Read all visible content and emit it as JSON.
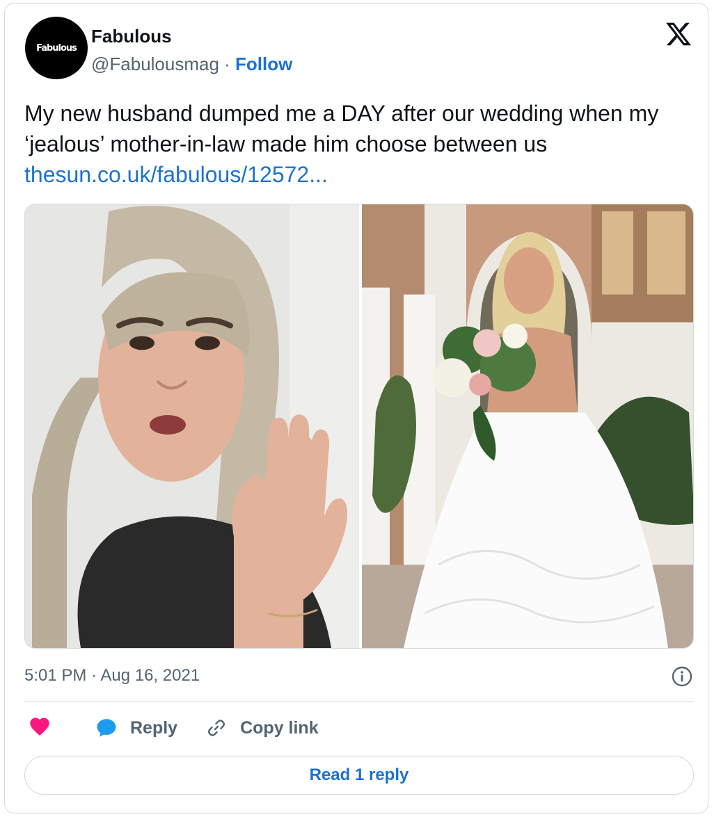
{
  "tweet": {
    "author": {
      "avatar_text": "Fabulous",
      "display_name": "Fabulous",
      "handle": "@Fabulousmag",
      "separator": " · ",
      "follow_label": "Follow"
    },
    "text": "My new husband dumped me a DAY after our wedding when my ‘jealous’ mother-in-law made him choose between us ",
    "link_text": "thesun.co.uk/fabulous/12572...",
    "timestamp": "5:01 PM · Aug 16, 2021",
    "actions": {
      "like_icon": "heart-icon",
      "reply_label": "Reply",
      "reply_icon": "speech-bubble-icon",
      "copy_label": "Copy link",
      "copy_icon": "link-icon"
    },
    "read_reply_label": "Read 1 reply"
  },
  "media": {
    "photos": [
      "woman-waving-photo",
      "bride-with-bouquet-photo"
    ]
  },
  "colors": {
    "link": "#1d72d0",
    "like": "#f91880",
    "reply_icon": "#1d9bf0",
    "muted_text": "#536471",
    "border": "#cfd9de"
  }
}
